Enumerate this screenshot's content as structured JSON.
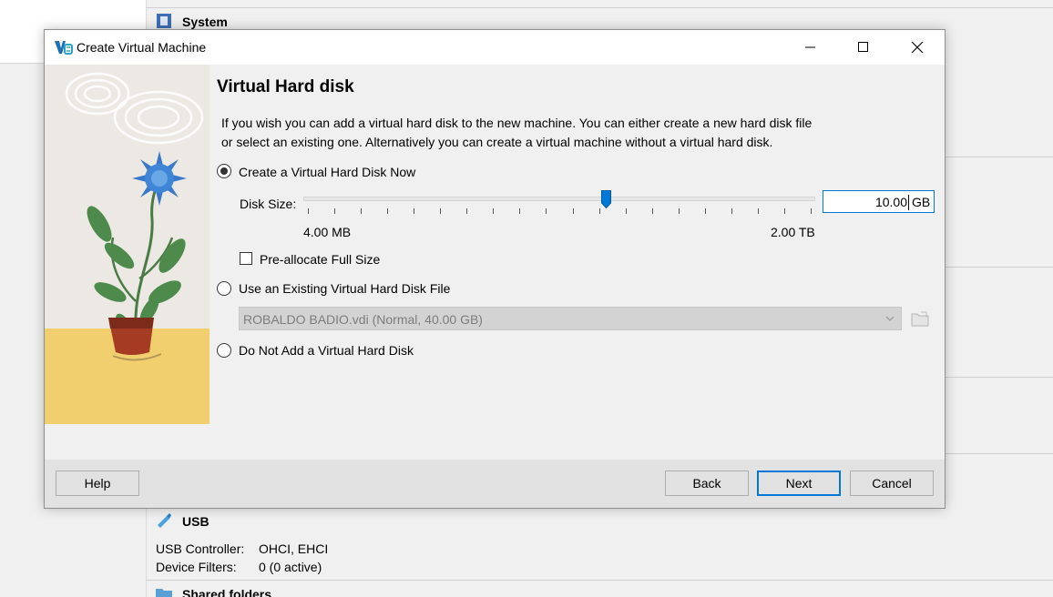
{
  "background": {
    "system_title": "System",
    "usb_title": "USB",
    "usb_rows": [
      {
        "key": "USB Controller:",
        "value": "OHCI, EHCI"
      },
      {
        "key": "Device Filters:",
        "value": "0 (0 active)"
      }
    ],
    "shared_title": "Shared folders"
  },
  "dialog": {
    "title": "Create Virtual Machine",
    "app_icon": "virtualbox-icon",
    "window_controls": [
      "minimize-icon",
      "maximize-icon",
      "close-icon"
    ],
    "page_title": "Virtual Hard disk",
    "description_lines": [
      "If you wish you can add a virtual hard disk to the new machine. You can either create a new hard disk file",
      "or select an existing one. Alternatively you can create a virtual machine without a virtual hard disk."
    ],
    "options": {
      "create_now": "Create a Virtual Hard Disk Now",
      "use_existing": "Use an Existing Virtual Hard Disk File",
      "do_not_add": "Do Not Add a Virtual Hard Disk"
    },
    "selected_option": "create_now",
    "disk_size_label": "Disk Size:",
    "disk_size_value": "10.00",
    "disk_size_unit": "GB",
    "slider_min_label": "4.00 MB",
    "slider_max_label": "2.00 TB",
    "slider_position": 0.59,
    "preallocate_label": "Pre-allocate Full Size",
    "preallocate_checked": false,
    "existing_disk_file": "ROBALDO BADIO.vdi (Normal, 40.00 GB)",
    "buttons": {
      "help": "Help",
      "back": "Back",
      "next": "Next",
      "cancel": "Cancel"
    },
    "accent_color": "#0078d7"
  }
}
